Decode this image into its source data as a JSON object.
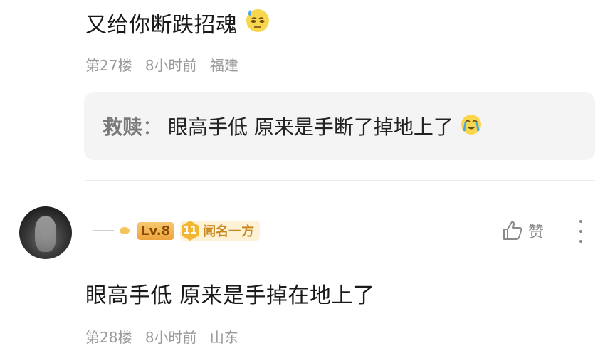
{
  "comment1": {
    "text": "又给你断跌招魂",
    "emoji": "sweat-face",
    "floor": "第27楼",
    "time": "8小时前",
    "location": "福建",
    "reply": {
      "user": "救赎",
      "separator": "：",
      "text": "眼高手低 原来是手断了掉地上了",
      "emoji": "crying-face"
    }
  },
  "comment2": {
    "user": {
      "name": "",
      "level": "Lv.8",
      "fan_level": "11",
      "fan_badge": "闻名一方"
    },
    "like_label": "赞",
    "text": "眼高手低 原来是手掉在地上了",
    "floor": "第28楼",
    "time": "8小时前",
    "location": "山东"
  },
  "icons": {
    "like": "thumb-up-icon",
    "more": "more-vertical-icon"
  },
  "colors": {
    "level_badge": "#eea43f",
    "fan_badge_bg": "#fdf1d6",
    "fan_badge_text": "#c8881e",
    "meta_text": "#9a9a9a",
    "reply_bg": "#f4f4f4"
  }
}
